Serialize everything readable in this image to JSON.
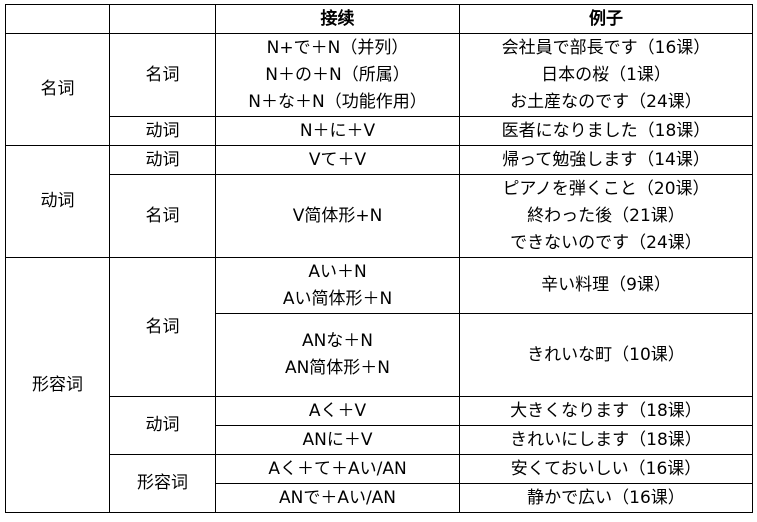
{
  "header": {
    "c1": "",
    "c2": "",
    "conn": "接续",
    "ex": "例子"
  },
  "g1": {
    "label": "名词",
    "s1": {
      "label": "名词",
      "conn": [
        "N+で＋N（并列）",
        "N＋の＋N（所属）",
        "N＋な＋N（功能作用）"
      ],
      "ex": [
        "会社員で部長です（16课）",
        "日本の桜（1课）",
        "お土産なのです（24课）"
      ]
    },
    "s2": {
      "label": "动词",
      "conn": "N＋に＋V",
      "ex": "医者になりました（18课）"
    }
  },
  "g2": {
    "label": "动词",
    "s1": {
      "label": "动词",
      "conn": "Vて＋V",
      "ex": "帰って勉強します（14课）"
    },
    "s2": {
      "label": "名词",
      "conn": "V简体形+N",
      "ex": [
        "ピアノを弾くこと（20课）",
        "終わった後（21课）",
        "できないのです（24课）"
      ]
    }
  },
  "g3": {
    "label": "形容词",
    "s1": {
      "label": "名词",
      "r1": {
        "conn": [
          "Aい＋N",
          "Aい简体形＋N"
        ],
        "ex": "辛い料理（9课）"
      },
      "r2": {
        "conn": [
          "ANな＋N",
          "AN简体形＋N"
        ],
        "ex": "きれいな町（10课）"
      }
    },
    "s2": {
      "label": "动词",
      "r1": {
        "conn": "Aく＋V",
        "ex": "大きくなります（18课）"
      },
      "r2": {
        "conn": "ANに＋V",
        "ex": "きれいにします（18课）"
      }
    },
    "s3": {
      "label": "形容词",
      "r1": {
        "conn": "Aく＋て＋Aい/AN",
        "ex": "安くておいしい（16课）"
      },
      "r2": {
        "conn": "ANで＋Aい/AN",
        "ex": "静かで広い（16课）"
      }
    }
  }
}
